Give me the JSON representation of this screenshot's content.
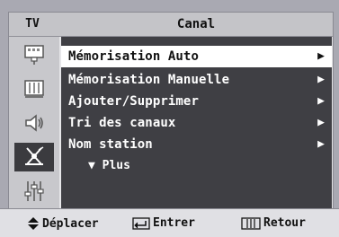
{
  "header": {
    "tv_label": "TV",
    "title": "Canal"
  },
  "sidebar": {
    "icons": [
      {
        "name": "picture-icon"
      },
      {
        "name": "sound-grid-icon"
      },
      {
        "name": "speaker-icon"
      },
      {
        "name": "antenna-icon",
        "active": true
      },
      {
        "name": "setup-sliders-icon"
      }
    ]
  },
  "menu": {
    "items": [
      {
        "label": "Mémorisation Auto",
        "arrow": "▶",
        "selected": true
      },
      {
        "label": "Mémorisation Manuelle",
        "arrow": "▶"
      },
      {
        "label": "Ajouter/Supprimer",
        "arrow": "▶"
      },
      {
        "label": "Tri des canaux",
        "arrow": "▶"
      },
      {
        "label": "Nom station",
        "arrow": "▶"
      }
    ],
    "more_label": "▼ Plus"
  },
  "footer": {
    "move_label": "Déplacer",
    "enter_label": "Entrer",
    "return_label": "Retour"
  },
  "colors": {
    "menu_bg": "#3f3f44",
    "selected_bg": "#ffffff",
    "frame_bg": "#e6e6e9",
    "outer_bg": "#a9a9b2"
  }
}
